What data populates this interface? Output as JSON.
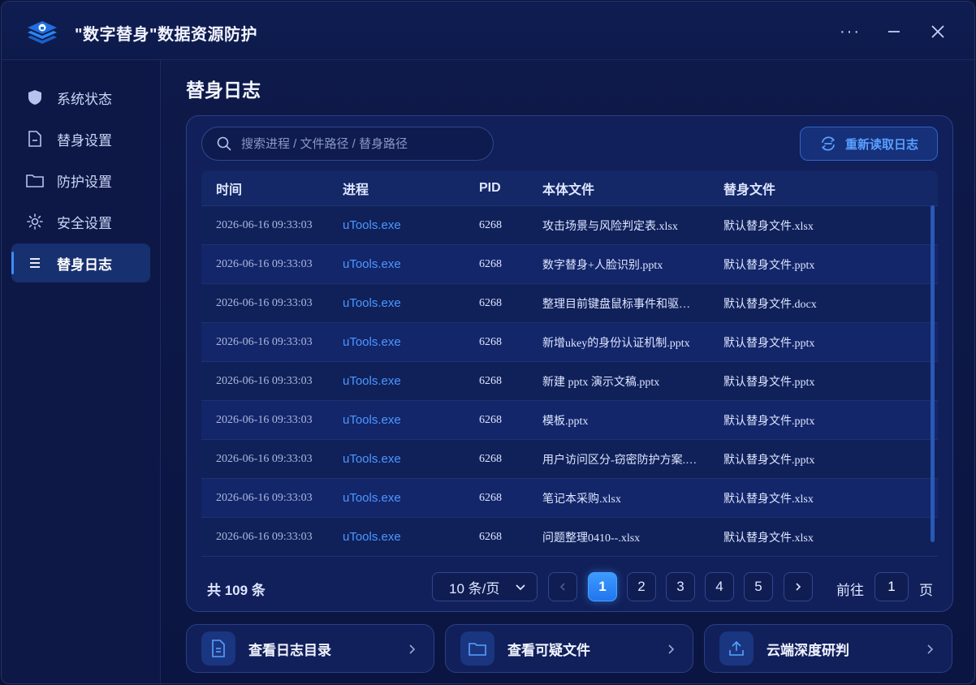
{
  "app": {
    "title": "\"数字替身\"数据资源防护"
  },
  "window_controls": {
    "more": "···"
  },
  "sidebar": {
    "items": [
      {
        "label": "系统状态",
        "icon": "shield-icon"
      },
      {
        "label": "替身设置",
        "icon": "document-icon"
      },
      {
        "label": "防护设置",
        "icon": "folder-icon"
      },
      {
        "label": "安全设置",
        "icon": "sun-settings-icon"
      },
      {
        "label": "替身日志",
        "icon": "list-icon",
        "active": true
      }
    ]
  },
  "page": {
    "title": "替身日志"
  },
  "search": {
    "placeholder": "搜索进程 / 文件路径 / 替身路径"
  },
  "toolbar": {
    "reload_label": "重新读取日志"
  },
  "table": {
    "headers": [
      "时间",
      "进程",
      "PID",
      "本体文件",
      "替身文件"
    ],
    "rows": [
      {
        "time": "2026-06-16 09:33:03",
        "process": "uTools.exe",
        "pid": "6268",
        "original": "攻击场景与风险判定表.xlsx",
        "duplicate": "默认替身文件.xlsx"
      },
      {
        "time": "2026-06-16 09:33:03",
        "process": "uTools.exe",
        "pid": "6268",
        "original": "数字替身+人脸识别.pptx",
        "duplicate": "默认替身文件.pptx"
      },
      {
        "time": "2026-06-16 09:33:03",
        "process": "uTools.exe",
        "pid": "6268",
        "original": "整理目前键盘鼠标事件和驱…",
        "duplicate": "默认替身文件.docx"
      },
      {
        "time": "2026-06-16 09:33:03",
        "process": "uTools.exe",
        "pid": "6268",
        "original": "新增ukey的身份认证机制.pptx",
        "duplicate": "默认替身文件.pptx"
      },
      {
        "time": "2026-06-16 09:33:03",
        "process": "uTools.exe",
        "pid": "6268",
        "original": "新建 pptx 演示文稿.pptx",
        "duplicate": "默认替身文件.pptx"
      },
      {
        "time": "2026-06-16 09:33:03",
        "process": "uTools.exe",
        "pid": "6268",
        "original": "模板.pptx",
        "duplicate": "默认替身文件.pptx"
      },
      {
        "time": "2026-06-16 09:33:03",
        "process": "uTools.exe",
        "pid": "6268",
        "original": "用户访问区分-窃密防护方案.…",
        "duplicate": "默认替身文件.pptx"
      },
      {
        "time": "2026-06-16 09:33:03",
        "process": "uTools.exe",
        "pid": "6268",
        "original": "笔记本采购.xlsx",
        "duplicate": "默认替身文件.xlsx"
      },
      {
        "time": "2026-06-16 09:33:03",
        "process": "uTools.exe",
        "pid": "6268",
        "original": "问题整理0410--.xlsx",
        "duplicate": "默认替身文件.xlsx"
      }
    ]
  },
  "pagination": {
    "total_label": "共 109 条",
    "page_size_label": "10 条/页",
    "pages": [
      "1",
      "2",
      "3",
      "4",
      "5"
    ],
    "current_page": "1",
    "goto_label": "前往",
    "goto_value": "1",
    "goto_suffix": "页"
  },
  "cards": [
    {
      "label": "查看日志目录",
      "icon": "document-icon"
    },
    {
      "label": "查看可疑文件",
      "icon": "folder-icon"
    },
    {
      "label": "云端深度研判",
      "icon": "upload-icon"
    }
  ],
  "colors": {
    "accent": "#3b8cff",
    "link": "#4d97ff",
    "background": "#0b1541"
  }
}
